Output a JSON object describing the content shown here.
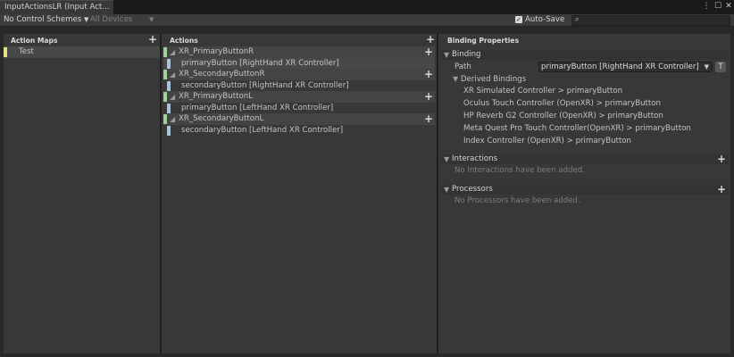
{
  "window": {
    "tab_title": "InputActionsLR (Input Act...",
    "colors": {
      "action_bar": "#9fcf9f",
      "binding_bar": "#a8c4d8",
      "map_bar": "#e8dd8b"
    }
  },
  "toolbar": {
    "control_schemes": "No Control Schemes",
    "devices": "All Devices",
    "auto_save_label": "Auto-Save",
    "auto_save_checked": true,
    "search_placeholder": ""
  },
  "action_maps": {
    "header": "Action Maps",
    "items": [
      {
        "label": "Test"
      }
    ]
  },
  "actions": {
    "header": "Actions",
    "items": [
      {
        "label": "XR_PrimaryButtonR",
        "binding": "primaryButton [RightHand XR Controller]"
      },
      {
        "label": "XR_SecondaryButtonR",
        "binding": "secondaryButton [RightHand XR Controller]"
      },
      {
        "label": "XR_PrimaryButtonL",
        "binding": "primaryButton [LeftHand XR Controller]"
      },
      {
        "label": "XR_SecondaryButtonL",
        "binding": "secondaryButton [LeftHand XR Controller]"
      }
    ]
  },
  "binding_properties": {
    "header": "Binding Properties",
    "binding_section": "Binding",
    "path_label": "Path",
    "path_value": "primaryButton [RightHand XR Controller]",
    "t_button": "T",
    "derived_label": "Derived Bindings",
    "derived": [
      "XR Simulated Controller > primaryButton",
      "Oculus Touch Controller (OpenXR) > primaryButton",
      "HP Reverb G2 Controller (OpenXR) > primaryButton",
      "Meta Quest Pro Touch Controller(OpenXR) > primaryButton",
      "Index Controller (OpenXR) > primaryButton"
    ],
    "interactions_section": "Interactions",
    "interactions_empty": "No Interactions have been added.",
    "processors_section": "Processors",
    "processors_empty": "No Processors have been added."
  }
}
